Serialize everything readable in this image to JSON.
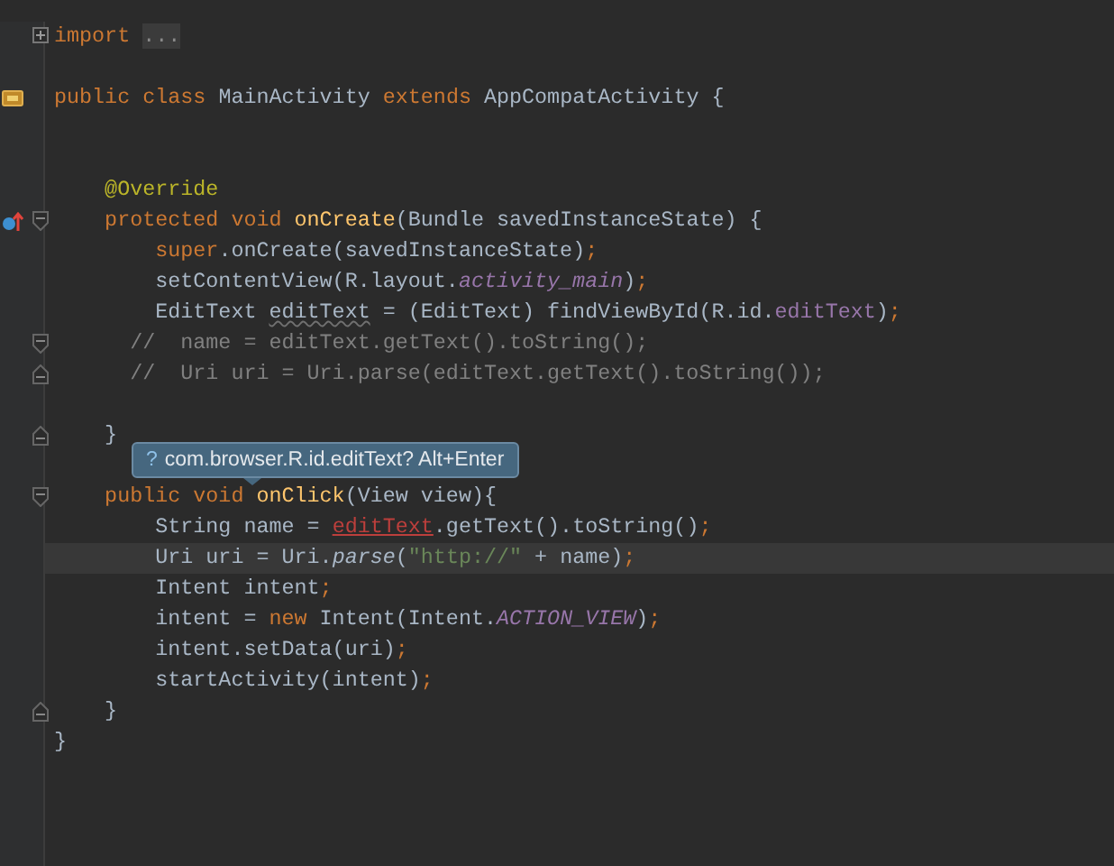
{
  "editor": {
    "lines": [
      {
        "fold": {
          "kind": "collapsed"
        },
        "current": false,
        "tokens": [
          {
            "kind": "keyword",
            "text": "import "
          },
          {
            "kind": "folded",
            "text": "..."
          }
        ]
      },
      {
        "current": false
      },
      {
        "gutter_icon": {
          "kind": "class"
        },
        "current": false,
        "tokens": [
          {
            "kind": "keyword",
            "text": "public class "
          },
          {
            "kind": "plain",
            "text": "MainActivity "
          },
          {
            "kind": "keyword",
            "text": "extends "
          },
          {
            "kind": "plain",
            "text": "AppCompatActivity {"
          }
        ]
      },
      {
        "current": false
      },
      {
        "current": false
      },
      {
        "current": false,
        "tokens": [
          {
            "kind": "annotation",
            "text": "    @Override"
          }
        ]
      },
      {
        "gutter_icon": {
          "kind": "override"
        },
        "fold": {
          "kind": "start"
        },
        "current": false,
        "tokens": [
          {
            "kind": "keyword",
            "text": "    protected void "
          },
          {
            "kind": "method",
            "text": "onCreate"
          },
          {
            "kind": "plain",
            "text": "(Bundle savedInstanceState) {"
          }
        ]
      },
      {
        "current": false,
        "tokens": [
          {
            "kind": "keyword",
            "text": "        super"
          },
          {
            "kind": "plain",
            "text": ".onCreate(savedInstanceState)"
          },
          {
            "kind": "keyword",
            "text": ";"
          }
        ]
      },
      {
        "current": false,
        "tokens": [
          {
            "kind": "plain",
            "text": "        setContentView(R.layout."
          },
          {
            "kind": "field",
            "text": "activity_main"
          },
          {
            "kind": "plain",
            "text": ")"
          },
          {
            "kind": "keyword",
            "text": ";"
          }
        ]
      },
      {
        "current": false,
        "tokens": [
          {
            "kind": "plain",
            "text": "        EditText "
          },
          {
            "kind": "weak",
            "text": "editText"
          },
          {
            "kind": "plain",
            "text": " = (EditText) findViewById(R.id."
          },
          {
            "kind": "field_plain",
            "text": "editText"
          },
          {
            "kind": "plain",
            "text": ")"
          },
          {
            "kind": "keyword",
            "text": ";"
          }
        ]
      },
      {
        "fold": {
          "kind": "start"
        },
        "current": false,
        "tokens": [
          {
            "kind": "comment",
            "text": "      //  name = editText.getText().toString();"
          }
        ]
      },
      {
        "fold": {
          "kind": "end"
        },
        "current": false,
        "tokens": [
          {
            "kind": "comment",
            "text": "      //  Uri uri = Uri.parse(editText.getText().toString());"
          }
        ]
      },
      {
        "current": false
      },
      {
        "fold": {
          "kind": "end"
        },
        "current": false,
        "tokens": [
          {
            "kind": "plain",
            "text": "    }"
          }
        ]
      },
      {
        "current": false
      },
      {
        "fold": {
          "kind": "start"
        },
        "current": false,
        "tokens": [
          {
            "kind": "keyword",
            "text": "    public void "
          },
          {
            "kind": "method",
            "text": "onClick"
          },
          {
            "kind": "plain",
            "text": "(View view){"
          }
        ]
      },
      {
        "current": false,
        "tokens": [
          {
            "kind": "plain",
            "text": "        String name = "
          },
          {
            "kind": "error",
            "text": "editText"
          },
          {
            "kind": "plain",
            "text": ".getText().toString()"
          },
          {
            "kind": "keyword",
            "text": ";"
          }
        ]
      },
      {
        "current": true,
        "tokens": [
          {
            "kind": "plain",
            "text": "        Uri uri = Uri."
          },
          {
            "kind": "static",
            "text": "parse"
          },
          {
            "kind": "plain",
            "text": "("
          },
          {
            "kind": "string",
            "text": "\"http://\""
          },
          {
            "kind": "plain",
            "text": " + name)"
          },
          {
            "kind": "keyword",
            "text": ";"
          }
        ]
      },
      {
        "current": false,
        "tokens": [
          {
            "kind": "plain",
            "text": "        Intent intent"
          },
          {
            "kind": "keyword",
            "text": ";"
          }
        ]
      },
      {
        "current": false,
        "tokens": [
          {
            "kind": "plain",
            "text": "        intent = "
          },
          {
            "kind": "keyword",
            "text": "new "
          },
          {
            "kind": "plain",
            "text": "Intent(Intent."
          },
          {
            "kind": "field",
            "text": "ACTION_VIEW"
          },
          {
            "kind": "plain",
            "text": ")"
          },
          {
            "kind": "keyword",
            "text": ";"
          }
        ]
      },
      {
        "current": false,
        "tokens": [
          {
            "kind": "plain",
            "text": "        intent.setData(uri)"
          },
          {
            "kind": "keyword",
            "text": ";"
          }
        ]
      },
      {
        "current": false,
        "tokens": [
          {
            "kind": "plain",
            "text": "        startActivity(intent)"
          },
          {
            "kind": "keyword",
            "text": ";"
          }
        ]
      },
      {
        "fold": {
          "kind": "end"
        },
        "current": false,
        "tokens": [
          {
            "kind": "plain",
            "text": "    }"
          }
        ]
      },
      {
        "current": false,
        "tokens": [
          {
            "kind": "plain",
            "text": "}"
          }
        ]
      }
    ]
  },
  "tooltip": {
    "icon": "?",
    "text": "com.browser.R.id.editText? Alt+Enter"
  }
}
